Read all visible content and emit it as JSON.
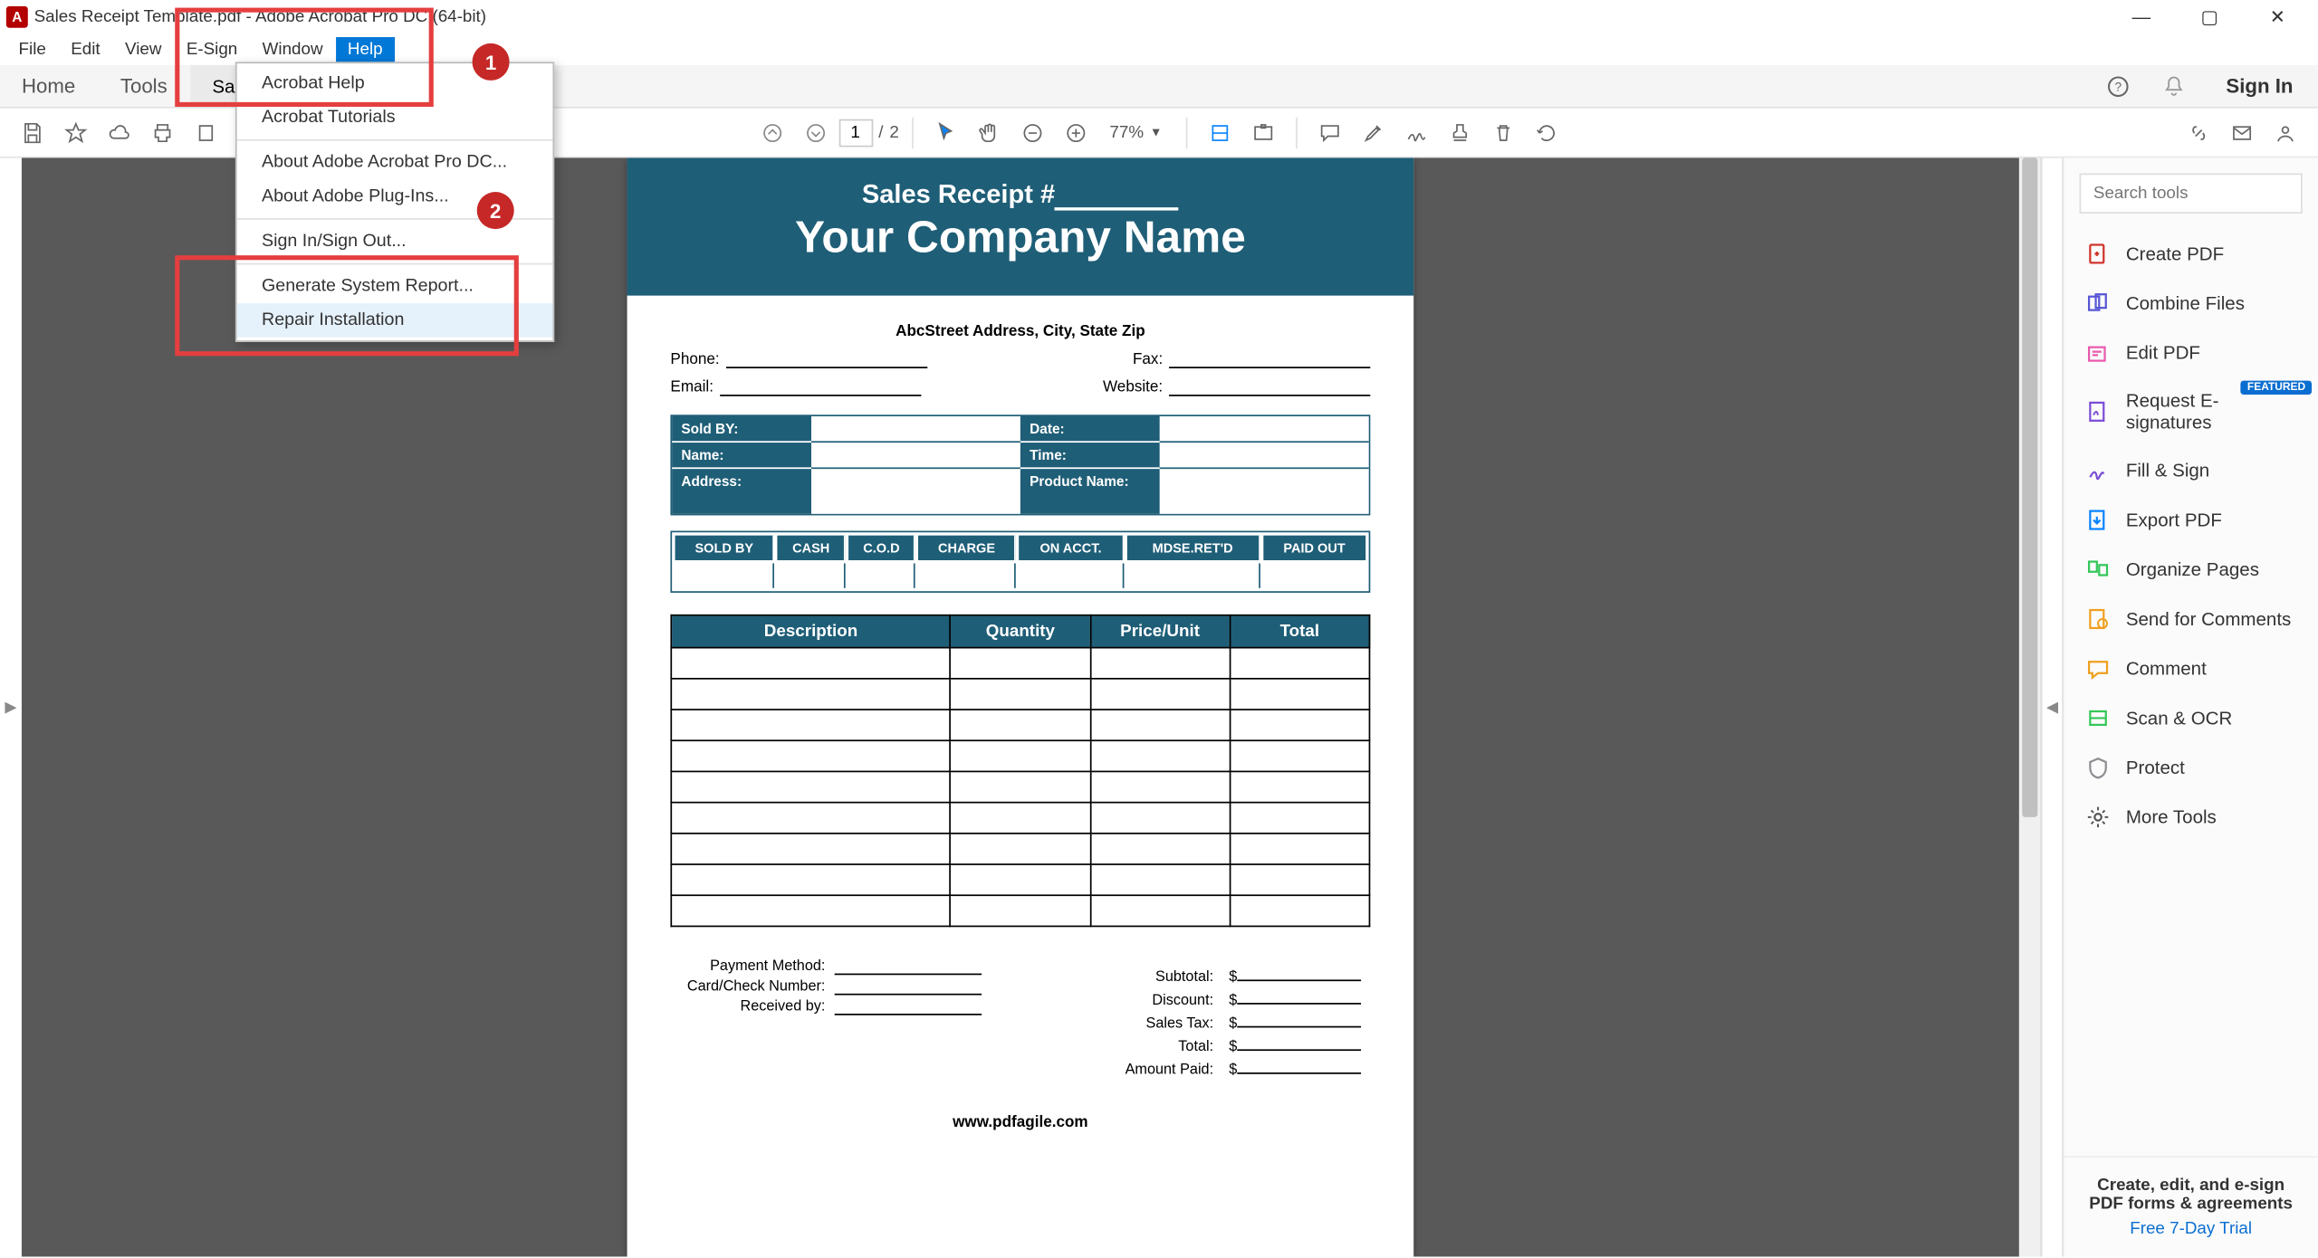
{
  "window": {
    "title": "Sales Receipt Template.pdf - Adobe Acrobat Pro DC (64-bit)",
    "minimize": "—",
    "maximize": "▢",
    "close": "✕"
  },
  "menubar": [
    "File",
    "Edit",
    "View",
    "E-Sign",
    "Window",
    "Help"
  ],
  "menubar_active_index": 5,
  "tabs": {
    "home": "Home",
    "tools": "Tools",
    "doc": "Sales",
    "signin": "Sign In"
  },
  "toolbar": {
    "page_current": "1",
    "page_sep": "/",
    "page_total": "2",
    "zoom": "77%"
  },
  "dropdown": {
    "items": [
      {
        "label": "Acrobat Help",
        "accel": ""
      },
      {
        "label": "Acrobat Tutorials",
        "accel": ""
      },
      {
        "sep": true
      },
      {
        "label": "About Adobe Acrobat Pro DC...",
        "accel": ""
      },
      {
        "label": "About Adobe Plug-Ins...",
        "accel": ""
      },
      {
        "sep": true
      },
      {
        "label": "Sign In/Sign Out...",
        "accel": ""
      },
      {
        "sep": true
      },
      {
        "label": "Generate System Report...",
        "accel": ""
      },
      {
        "label": "Repair Installation",
        "accel": "",
        "hover": true
      }
    ]
  },
  "annotations": {
    "one": "1",
    "two": "2"
  },
  "document": {
    "receipt_label": "Sales Receipt #",
    "company": "Your Company Name",
    "address": "AbcStreet Address, City, State Zip",
    "phone_lbl": "Phone:",
    "fax_lbl": "Fax:",
    "email_lbl": "Email:",
    "website_lbl": "Website:",
    "info_labels": {
      "sold_by": "Sold BY:",
      "date": "Date:",
      "name": "Name:",
      "time": "Time:",
      "address": "Address:",
      "product": "Product Name:"
    },
    "pay_headers": [
      "SOLD BY",
      "CASH",
      "C.O.D",
      "CHARGE",
      "ON ACCT.",
      "MDSE.RET'D",
      "PAID OUT"
    ],
    "item_headers": [
      "Description",
      "Quantity",
      "Price/Unit",
      "Total"
    ],
    "totals": {
      "subtotal": "Subtotal:",
      "discount": "Discount:",
      "tax": "Sales Tax:",
      "total": "Total:",
      "paid": "Amount Paid:",
      "cur": "$"
    },
    "paymeta": {
      "method": "Payment Method:",
      "card": "Card/Check Number:",
      "recv": "Received by:"
    },
    "footer": "www.pdfagile.com"
  },
  "sidebar": {
    "search_placeholder": "Search tools",
    "tools": [
      {
        "label": "Create PDF",
        "color": "#d0342c",
        "badge": null
      },
      {
        "label": "Combine Files",
        "color": "#5856d6",
        "badge": null
      },
      {
        "label": "Edit PDF",
        "color": "#e85aad",
        "badge": null
      },
      {
        "label": "Request E-signatures",
        "color": "#7b4dd6",
        "badge": "FEATURED"
      },
      {
        "label": "Fill & Sign",
        "color": "#7b4dd6",
        "badge": null
      },
      {
        "label": "Export PDF",
        "color": "#0a84ff",
        "badge": null
      },
      {
        "label": "Organize Pages",
        "color": "#34c759",
        "badge": null
      },
      {
        "label": "Send for Comments",
        "color": "#f0a020",
        "badge": null
      },
      {
        "label": "Comment",
        "color": "#f0a020",
        "badge": null
      },
      {
        "label": "Scan & OCR",
        "color": "#34c759",
        "badge": null
      },
      {
        "label": "Protect",
        "color": "#8e8e93",
        "badge": null
      },
      {
        "label": "More Tools",
        "color": "#555",
        "badge": null
      }
    ],
    "promo": "Create, edit, and e-sign PDF forms & agreements",
    "promo_link": "Free 7-Day Trial"
  }
}
